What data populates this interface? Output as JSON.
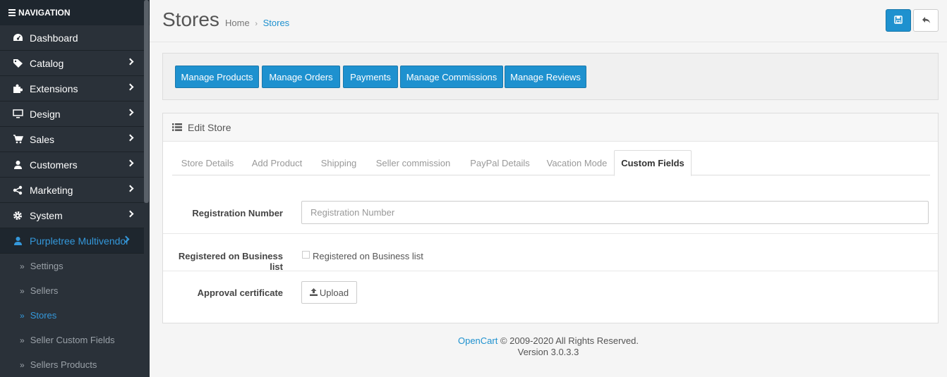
{
  "sidebar": {
    "header": "NAVIGATION",
    "items": [
      {
        "label": "Dashboard",
        "icon": "dashboard-icon"
      },
      {
        "label": "Catalog",
        "icon": "tags-icon"
      },
      {
        "label": "Extensions",
        "icon": "puzzle-icon"
      },
      {
        "label": "Design",
        "icon": "desktop-icon"
      },
      {
        "label": "Sales",
        "icon": "cart-icon"
      },
      {
        "label": "Customers",
        "icon": "user-icon"
      },
      {
        "label": "Marketing",
        "icon": "share-icon"
      },
      {
        "label": "System",
        "icon": "gear-icon"
      },
      {
        "label": "Purpletree Multivendor",
        "icon": "user-icon"
      }
    ],
    "sub_items": [
      {
        "label": "Settings"
      },
      {
        "label": "Sellers"
      },
      {
        "label": "Stores"
      },
      {
        "label": "Seller Custom Fields"
      },
      {
        "label": "Sellers Products"
      }
    ]
  },
  "header": {
    "title": "Stores",
    "breadcrumb": {
      "home": "Home",
      "sep": "›",
      "current": "Stores"
    }
  },
  "buttons": {
    "manage_products": "Manage Products",
    "manage_orders": "Manage Orders",
    "payments": "Payments",
    "manage_commissions": "Manage Commissions",
    "manage_reviews": "Manage Reviews"
  },
  "panel": {
    "title": "Edit Store",
    "tabs": [
      {
        "label": "Store Details"
      },
      {
        "label": "Add Product"
      },
      {
        "label": "Shipping"
      },
      {
        "label": "Seller commission"
      },
      {
        "label": "PayPal Details"
      },
      {
        "label": "Vacation Mode"
      },
      {
        "label": "Custom Fields"
      }
    ],
    "fields": {
      "registration_number_label": "Registration Number",
      "registration_number_placeholder": "Registration Number",
      "registration_number_value": "",
      "business_list_label": "Registered on Business list",
      "business_list_checkbox_label": "Registered on Business list",
      "approval_certificate_label": "Approval certificate",
      "upload_label": "Upload"
    }
  },
  "footer": {
    "link": "OpenCart",
    "rights": "© 2009-2020 All Rights Reserved.",
    "version": "Version 3.0.3.3"
  },
  "colors": {
    "accent": "#1e91cf",
    "sidebar_bg": "#2a3139",
    "active_link": "#3498db"
  }
}
